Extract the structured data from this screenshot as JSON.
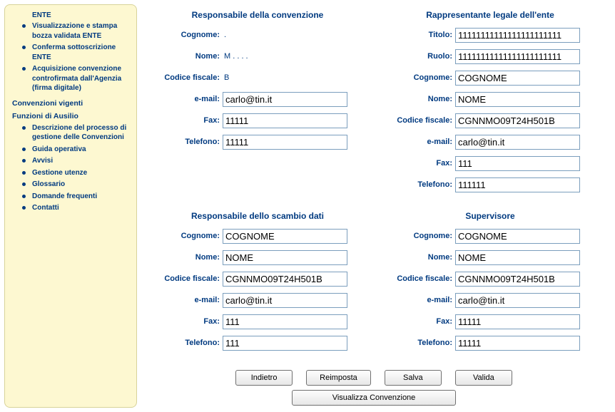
{
  "sidebar": {
    "ente_header": "ENTE",
    "ente_items": [
      "Visualizzazione e stampa bozza validata ENTE",
      "Conferma sottoscrizione ENTE",
      "Acquisizione convenzione controfirmata dall'Agenzia (firma digitale)"
    ],
    "sec1_title": "Convenzioni vigenti",
    "sec2_title": "Funzioni di Ausilio",
    "ausilio_items": [
      "Descrizione del processo di gestione delle Convenzioni",
      "Guida operativa",
      "Avvisi",
      "Gestione utenze",
      "Glossario",
      "Domande frequenti",
      "Contatti"
    ]
  },
  "labels": {
    "cognome": "Cognome:",
    "nome": "Nome:",
    "cf": "Codice fiscale:",
    "email": "e-mail:",
    "fax": "Fax:",
    "telefono": "Telefono:",
    "titolo": "Titolo:",
    "ruolo": "Ruolo:"
  },
  "sections": {
    "responsabile_convenzione": {
      "title": "Responsabile della convenzione",
      "cognome": ".",
      "nome": "M . . . .",
      "cf": "B",
      "email": "carlo@tin.it",
      "fax": "11111",
      "telefono": "11111"
    },
    "rappresentante_legale": {
      "title": "Rappresentante legale dell'ente",
      "titolo": "11111111111111111111111",
      "ruolo": "11111111111111111111111",
      "cognome": "COGNOME",
      "nome": "NOME",
      "cf": "CGNNMO09T24H501B",
      "email": "carlo@tin.it",
      "fax": "111",
      "telefono": "111111"
    },
    "responsabile_scambio": {
      "title": "Responsabile dello scambio dati",
      "cognome": "COGNOME",
      "nome": "NOME",
      "cf": "CGNNMO09T24H501B",
      "email": "carlo@tin.it",
      "fax": "111",
      "telefono": "111"
    },
    "supervisore": {
      "title": "Supervisore",
      "cognome": "COGNOME",
      "nome": "NOME",
      "cf": "CGNNMO09T24H501B",
      "email": "carlo@tin.it",
      "fax": "11111",
      "telefono": "11111"
    }
  },
  "buttons": {
    "indietro": "Indietro",
    "reimposta": "Reimposta",
    "salva": "Salva",
    "valida": "Valida",
    "visualizza": "Visualizza Convenzione"
  }
}
